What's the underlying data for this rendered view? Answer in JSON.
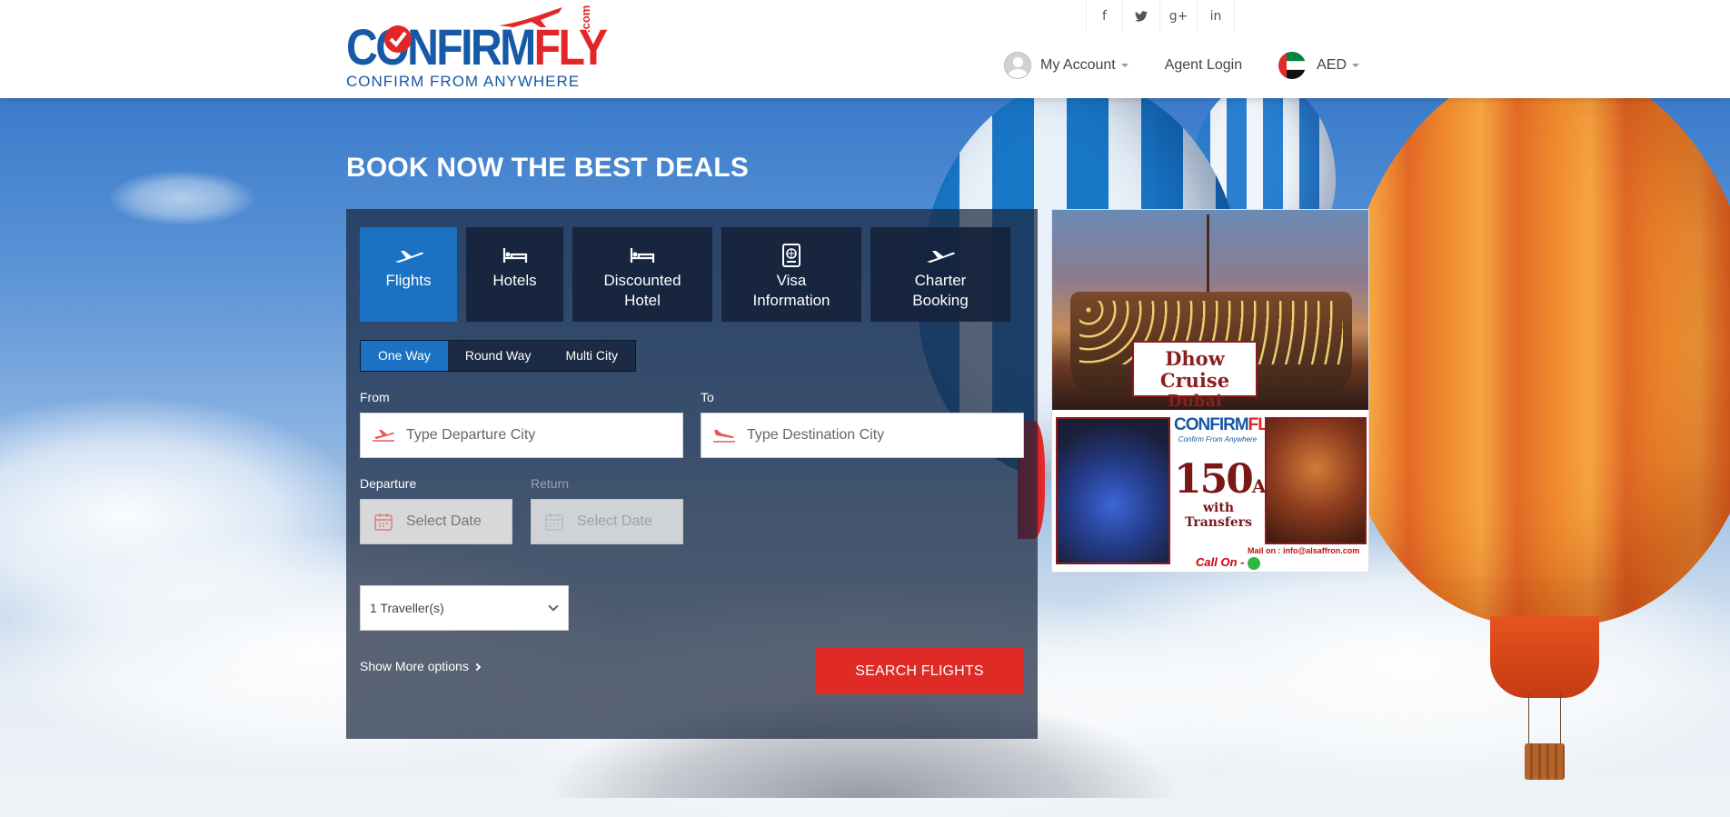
{
  "header": {
    "logo": {
      "word_confirm": "CONFIRM",
      "word_fly": "FLY",
      "domain": ".com",
      "tagline": "CONFIRM FROM ANYWHERE"
    },
    "social": [
      {
        "icon": "facebook-icon",
        "glyph": "f"
      },
      {
        "icon": "twitter-icon",
        "glyph": "🐦"
      },
      {
        "icon": "google-plus-icon",
        "glyph": "g+"
      },
      {
        "icon": "linkedin-icon",
        "glyph": "in"
      }
    ],
    "nav": {
      "my_account": "My Account",
      "agent_login": "Agent Login",
      "currency": "AED"
    }
  },
  "hero": {
    "title": "BOOK NOW THE BEST DEALS"
  },
  "booking": {
    "tabs": [
      {
        "label": "Flights",
        "icon": "airplane-icon",
        "active": true
      },
      {
        "label": "Hotels",
        "icon": "bed-icon",
        "active": false
      },
      {
        "label": "Discounted\nHotel",
        "icon": "bed-icon",
        "active": false
      },
      {
        "label": "Visa\nInformation",
        "icon": "passport-icon",
        "active": false
      },
      {
        "label": "Charter\nBooking",
        "icon": "airplane-icon",
        "active": false
      }
    ],
    "trip_types": [
      {
        "label": "One Way",
        "active": true
      },
      {
        "label": "Round Way",
        "active": false
      },
      {
        "label": "Multi City",
        "active": false
      }
    ],
    "from": {
      "label": "From",
      "placeholder": "Type Departure City"
    },
    "to": {
      "label": "To",
      "placeholder": "Type Destination City"
    },
    "departure": {
      "label": "Departure",
      "placeholder": "Select Date"
    },
    "return": {
      "label": "Return",
      "placeholder": "Select Date"
    },
    "travellers": {
      "selected": "1 Traveller(s)"
    },
    "show_more": "Show More options",
    "search_button": "SEARCH FLIGHTS"
  },
  "ad": {
    "heading_line1": "Dhow Cruise",
    "heading_line2": "Dubai Marina",
    "logo_confirm": "CONFIRM",
    "logo_fly": "FLY",
    "logo_tag": "Confirm From Anywhere",
    "price": "150",
    "currency": "AED",
    "subtitle": "with Transfers",
    "mail": "Mail on : info@alsaffron.com",
    "call": "Call On -"
  },
  "colors": {
    "brand_blue": "#1659a6",
    "brand_red": "#e22628",
    "active_tab": "#1b72c2",
    "search_button": "#e02a25"
  }
}
